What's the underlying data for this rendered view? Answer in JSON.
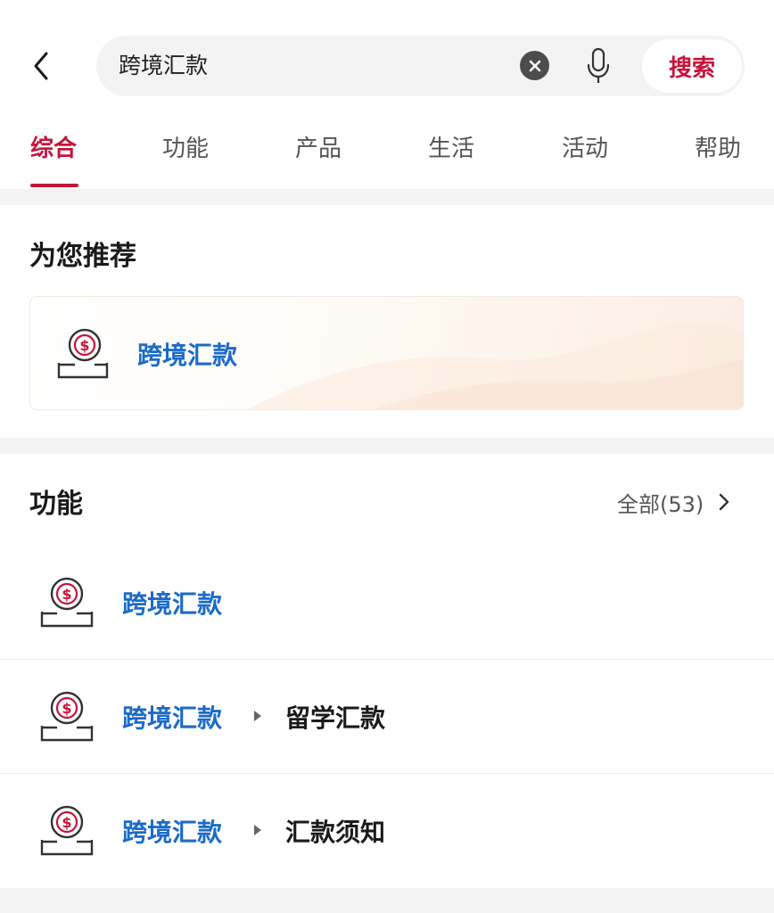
{
  "header": {
    "query": "跨境汇款",
    "search_label": "搜索"
  },
  "tabs": [
    {
      "label": "综合",
      "active": true
    },
    {
      "label": "功能",
      "active": false
    },
    {
      "label": "产品",
      "active": false
    },
    {
      "label": "生活",
      "active": false
    },
    {
      "label": "活动",
      "active": false
    },
    {
      "label": "帮助",
      "active": false
    }
  ],
  "recommend": {
    "title": "为您推荐",
    "item": {
      "label": "跨境汇款",
      "icon": "dollar-coin-icon"
    }
  },
  "functions": {
    "title": "功能",
    "all_label": "全部(53)",
    "items": [
      {
        "label": "跨境汇款",
        "sub": "",
        "icon": "dollar-coin-icon"
      },
      {
        "label": "跨境汇款",
        "sub": "留学汇款",
        "icon": "dollar-coin-icon"
      },
      {
        "label": "跨境汇款",
        "sub": "汇款须知",
        "icon": "dollar-coin-icon"
      }
    ]
  },
  "colors": {
    "accent": "#c4143b",
    "link": "#1b6bc7",
    "background": "#ffffff",
    "separator": "#f3f3f4"
  }
}
